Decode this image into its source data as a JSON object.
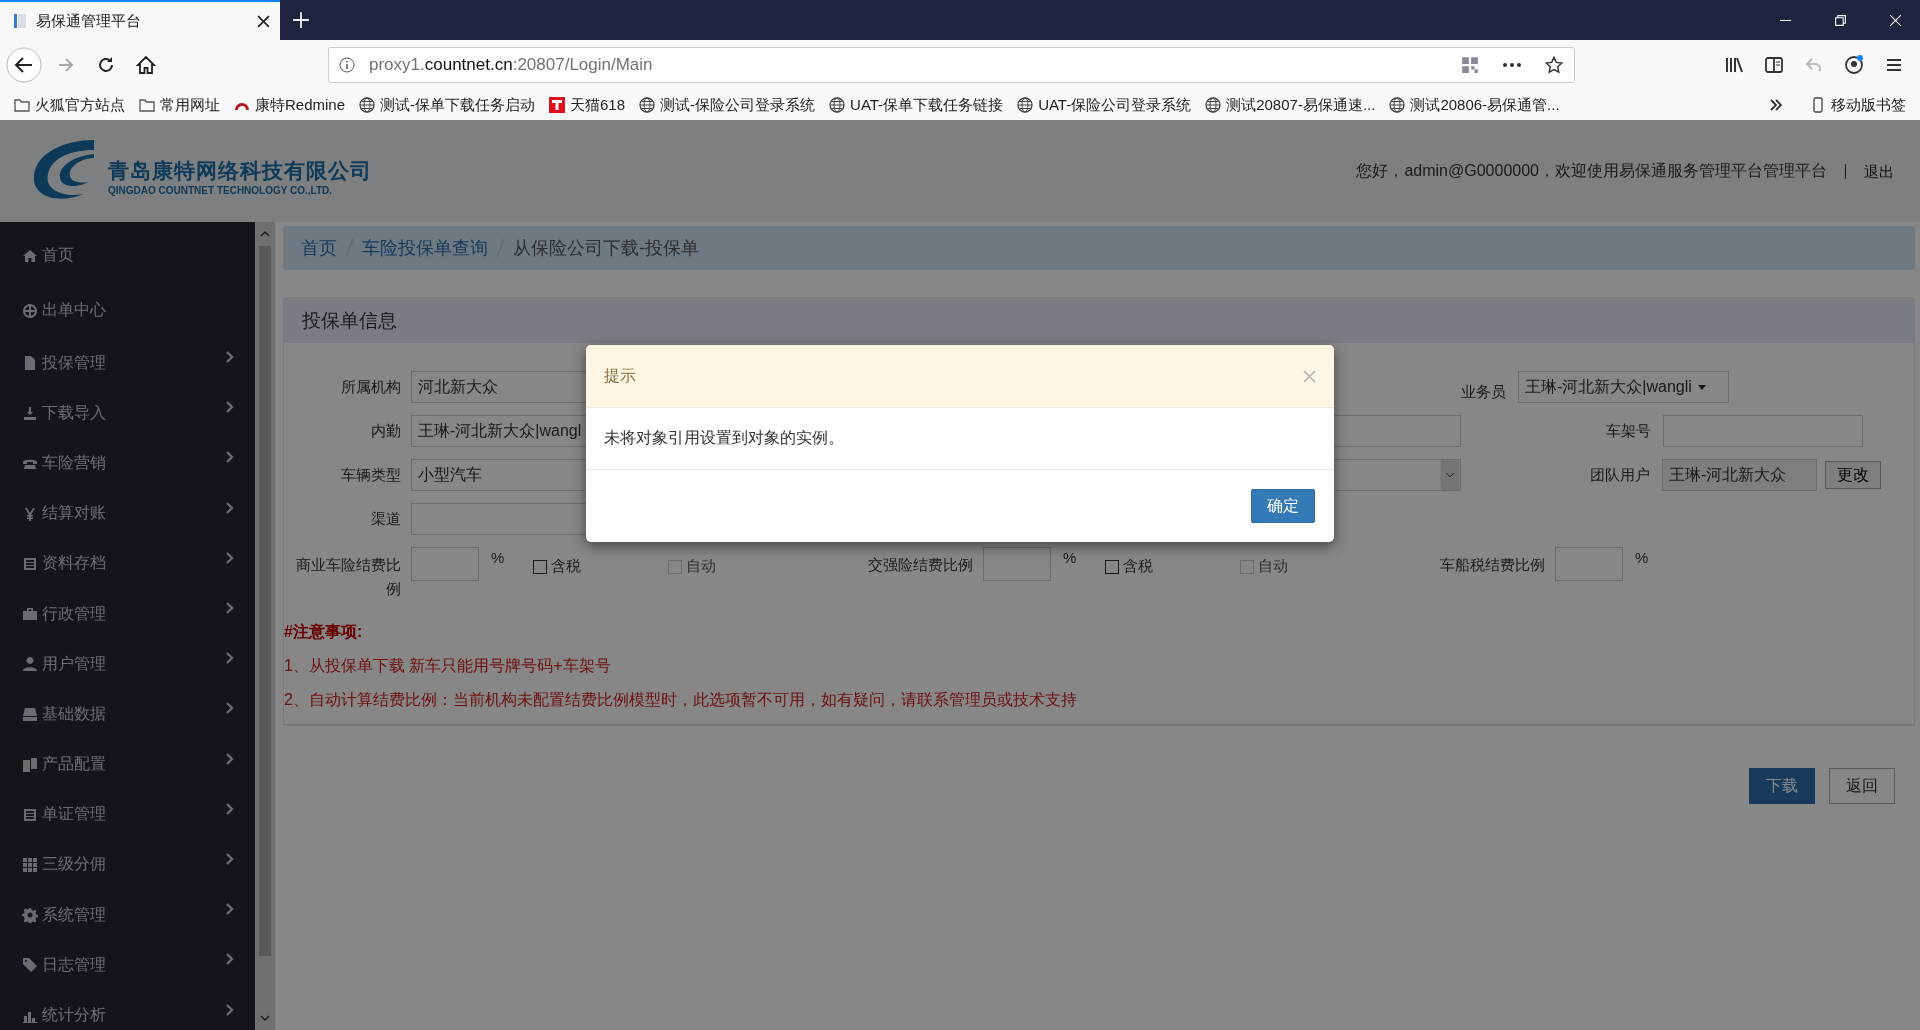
{
  "browser": {
    "tab_title": "易保通管理平台",
    "url_prefix": "proxy1.",
    "url_domain": "countnet.cn",
    "url_suffix": ":20807/Login/Main",
    "bookmarks": [
      "火狐官方站点",
      "常用网址",
      "康特Redmine",
      "测试-保单下载任务启动",
      "天猫618",
      "测试-保险公司登录系统",
      "UAT-保单下载任务链接",
      "UAT-保险公司登录系统",
      "测试20807-易保通速...",
      "测试20806-易保通管..."
    ],
    "mobile_bookmarks": "移动版书签"
  },
  "header": {
    "company_name": "青岛康特网络科技有限公司",
    "company_name_en": "QINGDAO COUNTNET TECHNOLOGY CO.,LTD.",
    "greeting": "您好，admin@G0000000，欢迎使用易保通服务管理平台管理平台",
    "logout": "退出"
  },
  "sidebar": {
    "items": [
      {
        "label": "首页",
        "has_submenu": false
      },
      {
        "label": "出单中心",
        "has_submenu": false
      },
      {
        "label": "投保管理",
        "has_submenu": true
      },
      {
        "label": "下载导入",
        "has_submenu": true
      },
      {
        "label": "车险营销",
        "has_submenu": true
      },
      {
        "label": "结算对账",
        "has_submenu": true
      },
      {
        "label": "资料存档",
        "has_submenu": true
      },
      {
        "label": "行政管理",
        "has_submenu": true
      },
      {
        "label": "用户管理",
        "has_submenu": true
      },
      {
        "label": "基础数据",
        "has_submenu": true
      },
      {
        "label": "产品配置",
        "has_submenu": true
      },
      {
        "label": "单证管理",
        "has_submenu": true
      },
      {
        "label": "三级分佣",
        "has_submenu": true
      },
      {
        "label": "系统管理",
        "has_submenu": true
      },
      {
        "label": "日志管理",
        "has_submenu": true
      },
      {
        "label": "统计分析",
        "has_submenu": true
      }
    ]
  },
  "breadcrumb": [
    "首页",
    "车险投保单查询",
    "从保险公司下载-投保单"
  ],
  "panel": {
    "title": "投保单信息",
    "rows": [
      [
        {
          "kind": "input",
          "label": "所属机构",
          "value": "河北新大众"
        },
        {
          "kind": "hidden"
        },
        {
          "kind": "dropdown",
          "label": "业务员",
          "value": "王琳-河北新大众|wangli"
        }
      ],
      [
        {
          "kind": "input",
          "label": "内勤",
          "value": "王琳-河北新大众|wangl"
        },
        {
          "kind": "input"
        },
        {
          "kind": "input",
          "label": "车架号"
        }
      ],
      [
        {
          "kind": "input",
          "label": "车辆类型",
          "value": "小型汽车"
        },
        {
          "kind": "select"
        },
        {
          "kind": "team",
          "label": "团队用户",
          "value": "王琳-河北新大众",
          "button": "更改"
        }
      ],
      [
        {
          "kind": "input",
          "label": "渠道"
        }
      ]
    ],
    "ratios": [
      {
        "label": "商业车险结费比例",
        "unit": "%",
        "tax": {
          "label": "含税",
          "checked": false
        },
        "auto": {
          "label": "自动",
          "checked": false,
          "disabled": true
        }
      },
      {
        "label": "交强险结费比例",
        "unit": "%",
        "tax": {
          "label": "含税",
          "checked": false
        },
        "auto": {
          "label": "自动",
          "checked": false,
          "disabled": true
        }
      },
      {
        "label": "车船税结费比例",
        "unit": "%"
      }
    ],
    "notes_title": "#注意事项:",
    "notes": [
      "1、从投保单下载 新车只能用号牌号码+车架号",
      "2、自动计算结费比例：当前机构未配置结费比例模型时，此选项暂不可用，如有疑问，请联系管理员或技术支持"
    ]
  },
  "actions": [
    {
      "label": "下载",
      "primary": true
    },
    {
      "label": "返回",
      "primary": false
    }
  ],
  "dialog": {
    "title": "提示",
    "message": "未将对象引用设置到对象的实例。",
    "ok": "确定"
  }
}
